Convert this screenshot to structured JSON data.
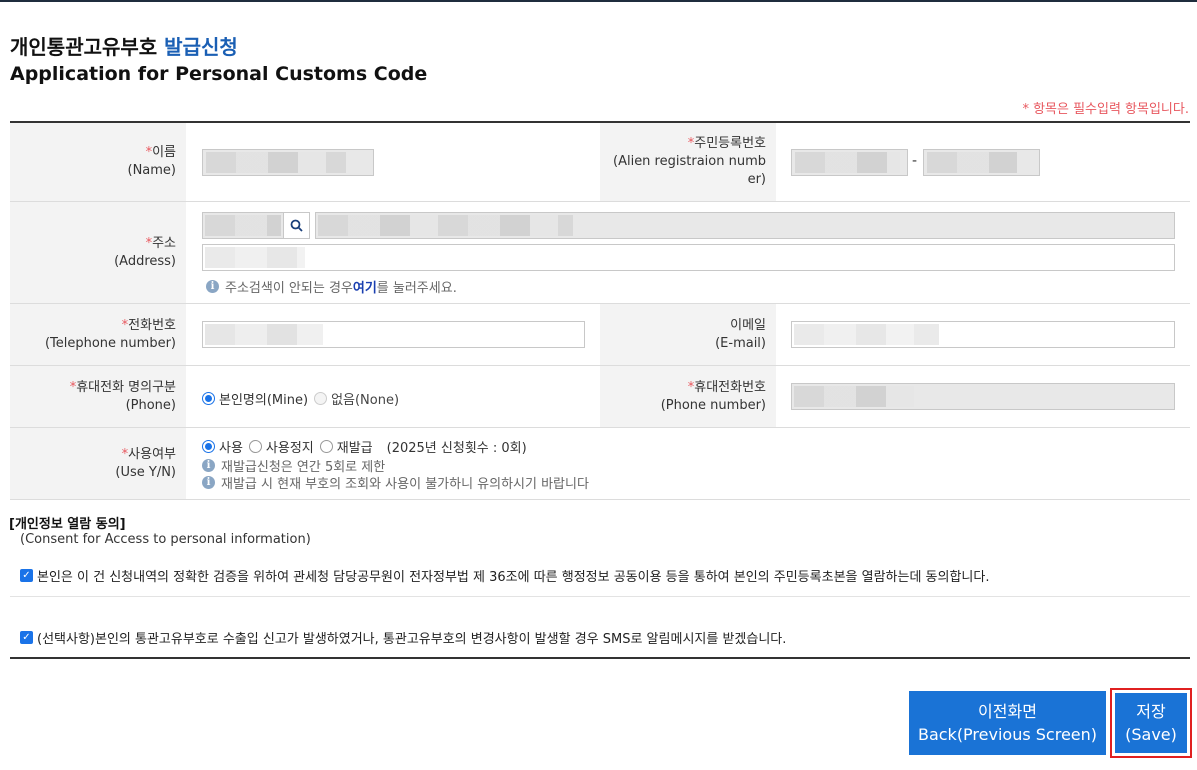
{
  "title": {
    "ko_main": "개인통관고유부호",
    "ko_accent": "발급신청",
    "en": "Application for Personal Customs Code"
  },
  "required_note": "* 항목은 필수입력 항목입니다.",
  "fields": {
    "name": {
      "label": "이름",
      "label_en": "(Name)",
      "required": "*"
    },
    "rrn": {
      "label": "주민등록번호",
      "label_en": "(Alien registraion numb er)",
      "required": "*",
      "separator": "-"
    },
    "address": {
      "label": "주소",
      "label_en": "(Address)",
      "required": "*",
      "hint_pre": "주소검색이 안되는 경우 ",
      "hint_link": "여기",
      "hint_post": "를 눌러주세요."
    },
    "phone": {
      "label": "전화번호",
      "label_en": "(Telephone number)",
      "required": "*"
    },
    "email": {
      "label": "이메일",
      "label_en": "(E-mail)"
    },
    "mobile_type": {
      "label": "휴대전화 명의구분",
      "label_en": "(Phone)",
      "required": "*",
      "options": [
        {
          "label": "본인명의(Mine)",
          "selected": true
        },
        {
          "label": "없음(None)",
          "selected": false
        }
      ]
    },
    "mobile": {
      "label": "휴대전화번호",
      "label_en": "(Phone number)",
      "required": "*"
    },
    "use": {
      "label": "사용여부",
      "label_en": "(Use Y/N)",
      "required": "*",
      "options": [
        {
          "label": "사용",
          "selected": true
        },
        {
          "label": "사용정지",
          "selected": false
        },
        {
          "label": "재발급",
          "selected": false
        }
      ],
      "count_text": "(2025년 신청횟수 : 0회)",
      "info1": "재발급신청은 연간 5회로 제한",
      "info2": "재발급 시 현재 부호의 조회와 사용이 불가하니 유의하시기 바랍니다"
    }
  },
  "consent": {
    "title": "[개인정보 열람 동의]",
    "subtitle": "(Consent for Access to personal information)",
    "item1": "본인은 이 건 신청내역의 정확한 검증을 위하여 관세청 담당공무원이 전자정부법 제 36조에 따른 행정정보 공동이용 등을 통하여 본인의 주민등록초본을 열람하는데 동의합니다.",
    "item2": "(선택사항)본인의 통관고유부호로 수출입 신고가 발생하였거나, 통관고유부호의 변경사항이 발생할 경우 SMS로 알림메시지를 받겠습니다."
  },
  "buttons": {
    "back_ko": "이전화면",
    "back_en": "Back(Previous Screen)",
    "save_ko": "저장",
    "save_en": "(Save)"
  },
  "colors": {
    "accent": "#1a5fb4",
    "button": "#1a73d6",
    "required": "#e8585f",
    "highlight": "#e02020"
  }
}
